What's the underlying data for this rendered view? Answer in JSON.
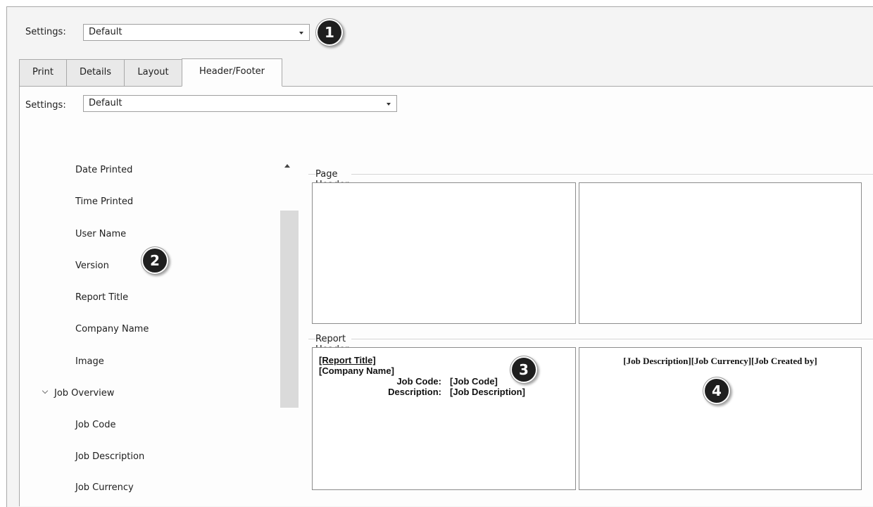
{
  "top_settings": {
    "label": "Settings:",
    "value": "Default"
  },
  "tabs": [
    {
      "label": "Print"
    },
    {
      "label": "Details"
    },
    {
      "label": "Layout"
    },
    {
      "label": "Header/Footer"
    }
  ],
  "inner_settings": {
    "label": "Settings:",
    "value": "Default"
  },
  "tree": {
    "items": [
      "Date Printed",
      "Time Printed",
      "User Name",
      "Version",
      "Report Title",
      "Company Name",
      "Image",
      "Job Overview",
      "Job Code",
      "Job Description",
      "Job Currency"
    ]
  },
  "page_header": {
    "title": "Page Header"
  },
  "report_header": {
    "title": "Report Header (first page only)",
    "left_box": {
      "line1": "[Report Title]",
      "line2": "[Company Name]",
      "job_code_label": "Job Code:",
      "job_code_value": "[Job Code]",
      "description_label": "Description:",
      "description_value": "[Job Description]"
    },
    "right_box": {
      "text": "[Job Description][Job Currency][Job Created by]"
    }
  },
  "callouts": [
    "1",
    "2",
    "3",
    "4"
  ],
  "colors": {
    "callout_bg": "#1f1f1f",
    "panel_bg": "#fdfdfd",
    "window_bg": "#f4f4f4"
  }
}
